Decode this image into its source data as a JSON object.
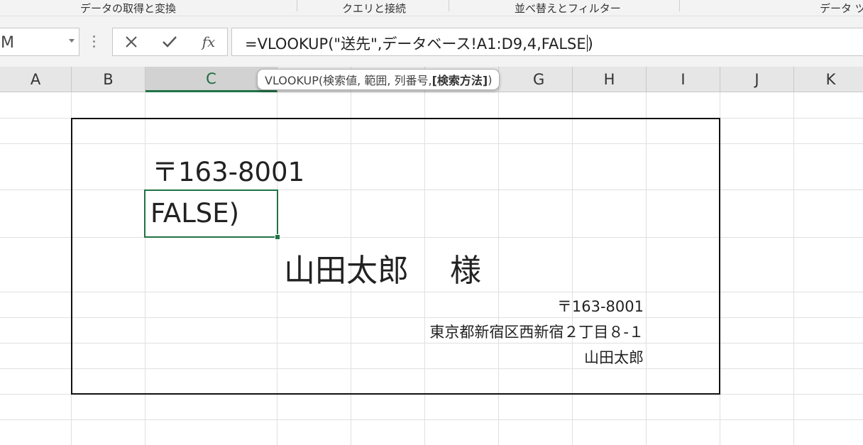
{
  "ribbon": {
    "groups": [
      "データの取得と変換",
      "クエリと接続",
      "並べ替えとフィルター",
      "データ ツ"
    ]
  },
  "namebox": {
    "value": "M"
  },
  "formula_bar": {
    "cancel_icon": "close-icon",
    "enter_icon": "check-icon",
    "fx_label": "fx",
    "formula": "=VLOOKUP(\"送先\",データベース!A1:D9,4,FALSE"
  },
  "columns": [
    "A",
    "B",
    "C",
    "G",
    "H",
    "I",
    "J",
    "K"
  ],
  "selected_column": "C",
  "tooltip": {
    "prefix": "VLOOKUP(検索値, 範囲, 列番号, ",
    "bold": "[検索方法]",
    "suffix": ")"
  },
  "label": {
    "postal_top": "〒163-8001",
    "edit_cell": "FALSE)",
    "recipient": "山田太郎　 様",
    "sender_postal": "〒163-8001",
    "sender_address": "東京都新宿区西新宿２丁目８-１",
    "sender_name": "山田太郎"
  },
  "colors": {
    "accent": "#217346",
    "grid": "#e0e0e0",
    "header_bg": "#e6e6e6"
  }
}
